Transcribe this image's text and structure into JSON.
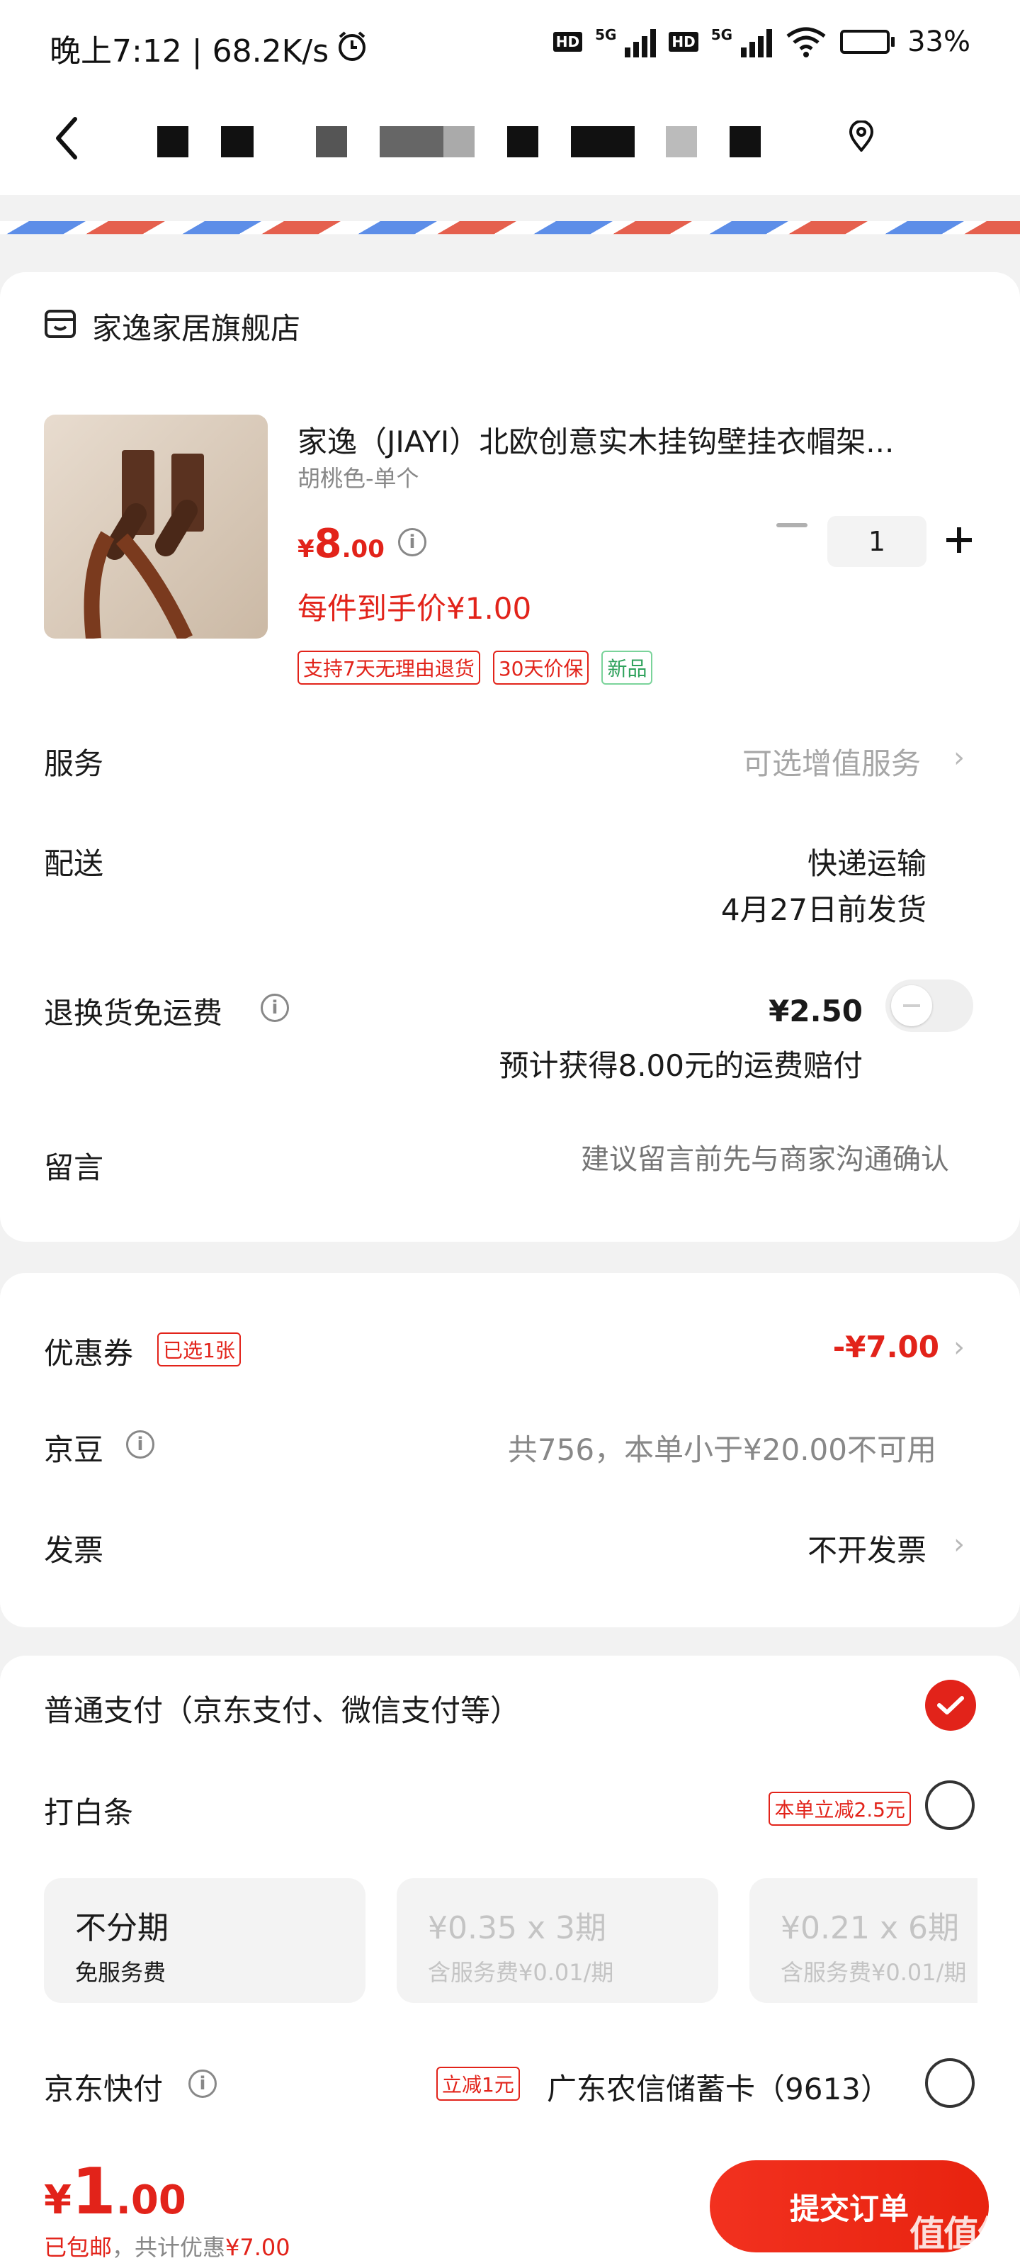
{
  "status_bar": {
    "time": "晚上7:12 | 68.2K/s",
    "net_label_1": "5G",
    "net_label_2": "5G",
    "hd_label": "HD",
    "battery": "33%"
  },
  "shop": {
    "name": "家逸家居旗舰店"
  },
  "product": {
    "title": "家逸（JIAYI）北欧创意实木挂钩壁挂衣帽架...",
    "variant": "胡桃色-单个",
    "price_symbol": "¥",
    "price_int": "8",
    "price_dec": ".00",
    "final_price": "每件到手价¥1.00",
    "quantity": "1",
    "tags": [
      "支持7天无理由退货",
      "30天价保",
      "新品"
    ]
  },
  "rows": {
    "service_label": "服务",
    "service_value": "可选增值服务",
    "delivery_label": "配送",
    "delivery_value_1": "快递运输",
    "delivery_value_2": "4月27日前发货",
    "return_label": "退换货免运费",
    "return_price": "¥2.50",
    "return_note": "预计获得8.00元的运费赔付",
    "message_label": "留言",
    "message_placeholder": "建议留言前先与商家沟通确认"
  },
  "discounts": {
    "coupon_label": "优惠券",
    "coupon_tag": "已选1张",
    "coupon_value": "-¥7.00",
    "beans_label": "京豆",
    "beans_value": "共756，本单小于¥20.00不可用",
    "invoice_label": "发票",
    "invoice_value": "不开发票"
  },
  "payment": {
    "normal_label": "普通支付（京东支付、微信支付等）",
    "baitiao_label": "打白条",
    "baitiao_tag": "本单立减2.5元",
    "plans": [
      {
        "title": "不分期",
        "sub": "免服务费"
      },
      {
        "title": "¥0.35 x 3期",
        "sub": "含服务费¥0.01/期"
      },
      {
        "title": "¥0.21 x 6期",
        "sub": "含服务费¥0.01/期"
      }
    ],
    "quickpay_label": "京东快付",
    "quickpay_tag": "立减1元",
    "quickpay_card": "广东农信储蓄卡（9613）"
  },
  "footer": {
    "total_symbol": "¥",
    "total_int": "1",
    "total_dec": ".00",
    "shipping_note": "已包邮",
    "discount_note": "，共计优惠",
    "discount_value": "¥7.00",
    "submit_label": "提交订单",
    "watermark": "值值值"
  },
  "colors": {
    "accent": "#e2231a",
    "background": "#f2f2f2",
    "card": "#ffffff"
  }
}
